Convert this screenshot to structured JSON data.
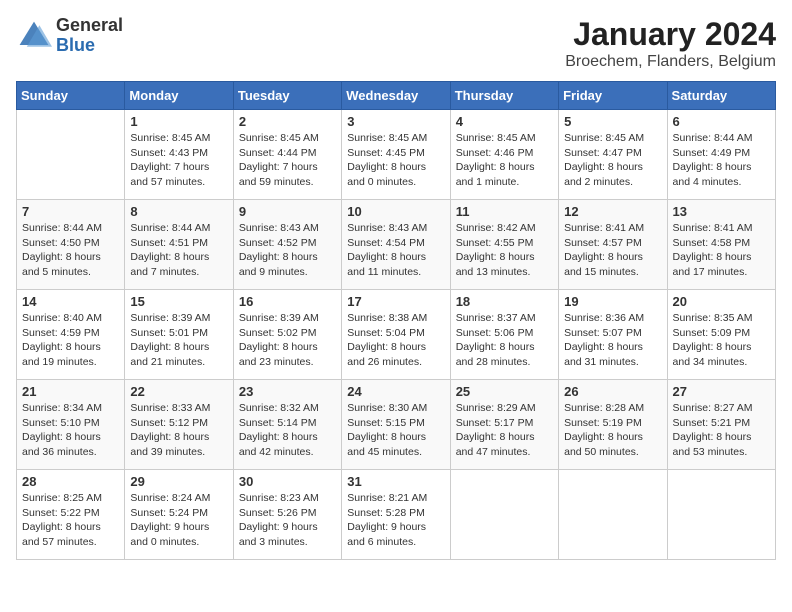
{
  "header": {
    "logo_general": "General",
    "logo_blue": "Blue",
    "title": "January 2024",
    "subtitle": "Broechem, Flanders, Belgium"
  },
  "days_of_week": [
    "Sunday",
    "Monday",
    "Tuesday",
    "Wednesday",
    "Thursday",
    "Friday",
    "Saturday"
  ],
  "weeks": [
    [
      {
        "day": "",
        "sunrise": "",
        "sunset": "",
        "daylight": ""
      },
      {
        "day": "1",
        "sunrise": "Sunrise: 8:45 AM",
        "sunset": "Sunset: 4:43 PM",
        "daylight": "Daylight: 7 hours and 57 minutes."
      },
      {
        "day": "2",
        "sunrise": "Sunrise: 8:45 AM",
        "sunset": "Sunset: 4:44 PM",
        "daylight": "Daylight: 7 hours and 59 minutes."
      },
      {
        "day": "3",
        "sunrise": "Sunrise: 8:45 AM",
        "sunset": "Sunset: 4:45 PM",
        "daylight": "Daylight: 8 hours and 0 minutes."
      },
      {
        "day": "4",
        "sunrise": "Sunrise: 8:45 AM",
        "sunset": "Sunset: 4:46 PM",
        "daylight": "Daylight: 8 hours and 1 minute."
      },
      {
        "day": "5",
        "sunrise": "Sunrise: 8:45 AM",
        "sunset": "Sunset: 4:47 PM",
        "daylight": "Daylight: 8 hours and 2 minutes."
      },
      {
        "day": "6",
        "sunrise": "Sunrise: 8:44 AM",
        "sunset": "Sunset: 4:49 PM",
        "daylight": "Daylight: 8 hours and 4 minutes."
      }
    ],
    [
      {
        "day": "7",
        "sunrise": "Sunrise: 8:44 AM",
        "sunset": "Sunset: 4:50 PM",
        "daylight": "Daylight: 8 hours and 5 minutes."
      },
      {
        "day": "8",
        "sunrise": "Sunrise: 8:44 AM",
        "sunset": "Sunset: 4:51 PM",
        "daylight": "Daylight: 8 hours and 7 minutes."
      },
      {
        "day": "9",
        "sunrise": "Sunrise: 8:43 AM",
        "sunset": "Sunset: 4:52 PM",
        "daylight": "Daylight: 8 hours and 9 minutes."
      },
      {
        "day": "10",
        "sunrise": "Sunrise: 8:43 AM",
        "sunset": "Sunset: 4:54 PM",
        "daylight": "Daylight: 8 hours and 11 minutes."
      },
      {
        "day": "11",
        "sunrise": "Sunrise: 8:42 AM",
        "sunset": "Sunset: 4:55 PM",
        "daylight": "Daylight: 8 hours and 13 minutes."
      },
      {
        "day": "12",
        "sunrise": "Sunrise: 8:41 AM",
        "sunset": "Sunset: 4:57 PM",
        "daylight": "Daylight: 8 hours and 15 minutes."
      },
      {
        "day": "13",
        "sunrise": "Sunrise: 8:41 AM",
        "sunset": "Sunset: 4:58 PM",
        "daylight": "Daylight: 8 hours and 17 minutes."
      }
    ],
    [
      {
        "day": "14",
        "sunrise": "Sunrise: 8:40 AM",
        "sunset": "Sunset: 4:59 PM",
        "daylight": "Daylight: 8 hours and 19 minutes."
      },
      {
        "day": "15",
        "sunrise": "Sunrise: 8:39 AM",
        "sunset": "Sunset: 5:01 PM",
        "daylight": "Daylight: 8 hours and 21 minutes."
      },
      {
        "day": "16",
        "sunrise": "Sunrise: 8:39 AM",
        "sunset": "Sunset: 5:02 PM",
        "daylight": "Daylight: 8 hours and 23 minutes."
      },
      {
        "day": "17",
        "sunrise": "Sunrise: 8:38 AM",
        "sunset": "Sunset: 5:04 PM",
        "daylight": "Daylight: 8 hours and 26 minutes."
      },
      {
        "day": "18",
        "sunrise": "Sunrise: 8:37 AM",
        "sunset": "Sunset: 5:06 PM",
        "daylight": "Daylight: 8 hours and 28 minutes."
      },
      {
        "day": "19",
        "sunrise": "Sunrise: 8:36 AM",
        "sunset": "Sunset: 5:07 PM",
        "daylight": "Daylight: 8 hours and 31 minutes."
      },
      {
        "day": "20",
        "sunrise": "Sunrise: 8:35 AM",
        "sunset": "Sunset: 5:09 PM",
        "daylight": "Daylight: 8 hours and 34 minutes."
      }
    ],
    [
      {
        "day": "21",
        "sunrise": "Sunrise: 8:34 AM",
        "sunset": "Sunset: 5:10 PM",
        "daylight": "Daylight: 8 hours and 36 minutes."
      },
      {
        "day": "22",
        "sunrise": "Sunrise: 8:33 AM",
        "sunset": "Sunset: 5:12 PM",
        "daylight": "Daylight: 8 hours and 39 minutes."
      },
      {
        "day": "23",
        "sunrise": "Sunrise: 8:32 AM",
        "sunset": "Sunset: 5:14 PM",
        "daylight": "Daylight: 8 hours and 42 minutes."
      },
      {
        "day": "24",
        "sunrise": "Sunrise: 8:30 AM",
        "sunset": "Sunset: 5:15 PM",
        "daylight": "Daylight: 8 hours and 45 minutes."
      },
      {
        "day": "25",
        "sunrise": "Sunrise: 8:29 AM",
        "sunset": "Sunset: 5:17 PM",
        "daylight": "Daylight: 8 hours and 47 minutes."
      },
      {
        "day": "26",
        "sunrise": "Sunrise: 8:28 AM",
        "sunset": "Sunset: 5:19 PM",
        "daylight": "Daylight: 8 hours and 50 minutes."
      },
      {
        "day": "27",
        "sunrise": "Sunrise: 8:27 AM",
        "sunset": "Sunset: 5:21 PM",
        "daylight": "Daylight: 8 hours and 53 minutes."
      }
    ],
    [
      {
        "day": "28",
        "sunrise": "Sunrise: 8:25 AM",
        "sunset": "Sunset: 5:22 PM",
        "daylight": "Daylight: 8 hours and 57 minutes."
      },
      {
        "day": "29",
        "sunrise": "Sunrise: 8:24 AM",
        "sunset": "Sunset: 5:24 PM",
        "daylight": "Daylight: 9 hours and 0 minutes."
      },
      {
        "day": "30",
        "sunrise": "Sunrise: 8:23 AM",
        "sunset": "Sunset: 5:26 PM",
        "daylight": "Daylight: 9 hours and 3 minutes."
      },
      {
        "day": "31",
        "sunrise": "Sunrise: 8:21 AM",
        "sunset": "Sunset: 5:28 PM",
        "daylight": "Daylight: 9 hours and 6 minutes."
      },
      {
        "day": "",
        "sunrise": "",
        "sunset": "",
        "daylight": ""
      },
      {
        "day": "",
        "sunrise": "",
        "sunset": "",
        "daylight": ""
      },
      {
        "day": "",
        "sunrise": "",
        "sunset": "",
        "daylight": ""
      }
    ]
  ]
}
